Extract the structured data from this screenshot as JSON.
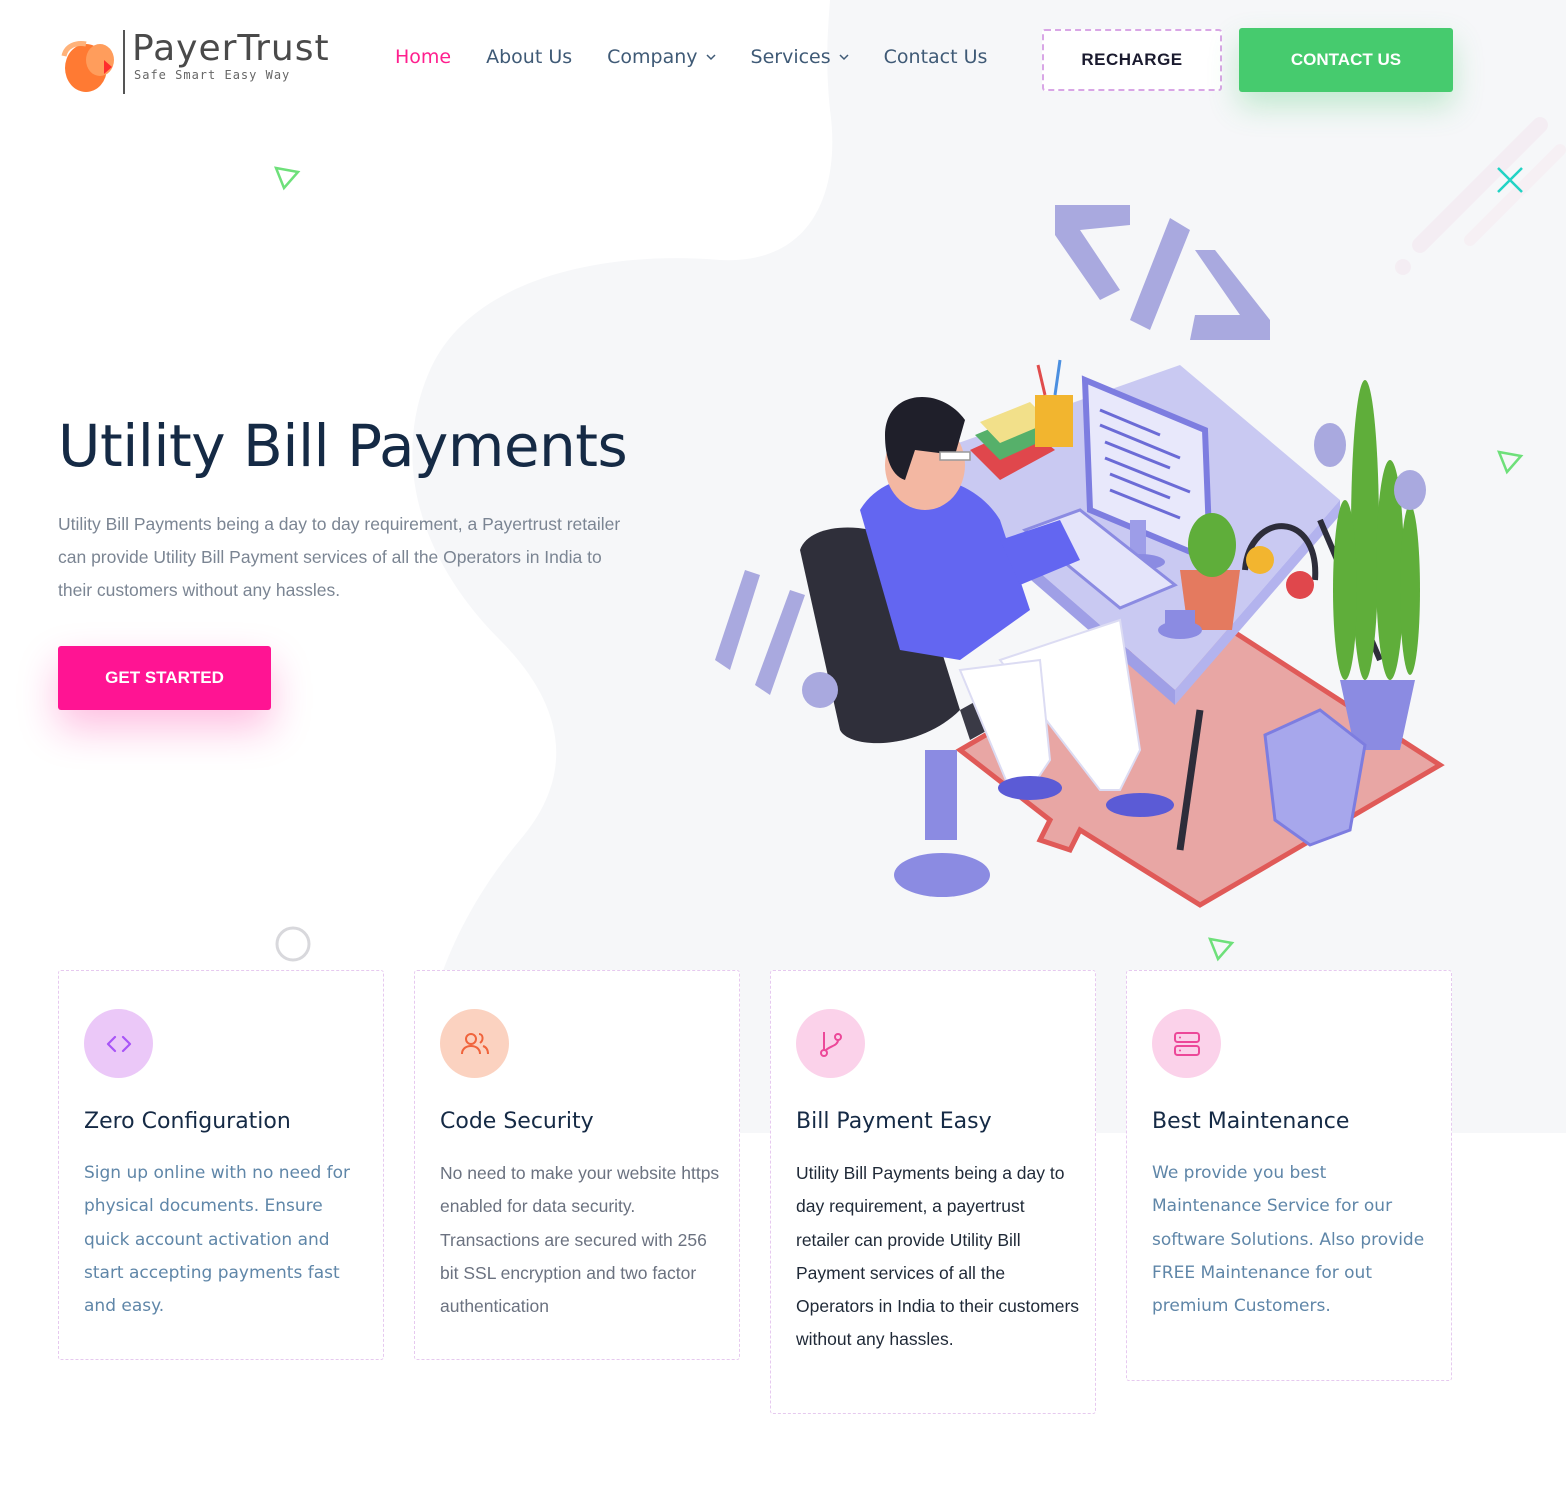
{
  "brand": {
    "name": "PayerTrust",
    "tagline": "Safe Smart Easy Way"
  },
  "nav": {
    "items": [
      {
        "label": "Home",
        "active": true
      },
      {
        "label": "About Us"
      },
      {
        "label": "Company",
        "dropdown": true
      },
      {
        "label": "Services",
        "dropdown": true
      },
      {
        "label": "Contact Us"
      }
    ],
    "recharge_label": "RECHARGE",
    "contact_label": "CONTACT US"
  },
  "hero": {
    "title": "Utility Bill Payments",
    "description": "Utility Bill Payments being a day to day requirement, a Payertrust retailer can provide Utility Bill Payment services of all the Operators in India to their customers without any hassles.",
    "cta_label": "GET STARTED"
  },
  "features": [
    {
      "icon": "code-icon",
      "title": "Zero Configuration",
      "text": "Sign up online with no need for physical documents. Ensure quick account activation and start accepting payments fast and easy."
    },
    {
      "icon": "users-icon",
      "title": "Code Security",
      "text": "No need to make your website https enabled for data security. Transactions are secured with 256 bit SSL encryption and two factor authentication"
    },
    {
      "icon": "git-branch-icon",
      "title": "Bill Payment Easy",
      "text": "Utility Bill Payments being a day to day requirement, a payertrust retailer can provide Utility Bill Payment services of all the Operators in India to their customers without any hassles."
    },
    {
      "icon": "server-icon",
      "title": "Best Maintenance",
      "text": "We provide you best Maintenance Service for our software Solutions. Also provide FREE Maintenance for out premium Customers."
    }
  ],
  "colors": {
    "accent_pink": "#ff1493",
    "accent_green": "#46cb6e",
    "heading": "#152a45",
    "nav_text": "#3f5a76"
  }
}
